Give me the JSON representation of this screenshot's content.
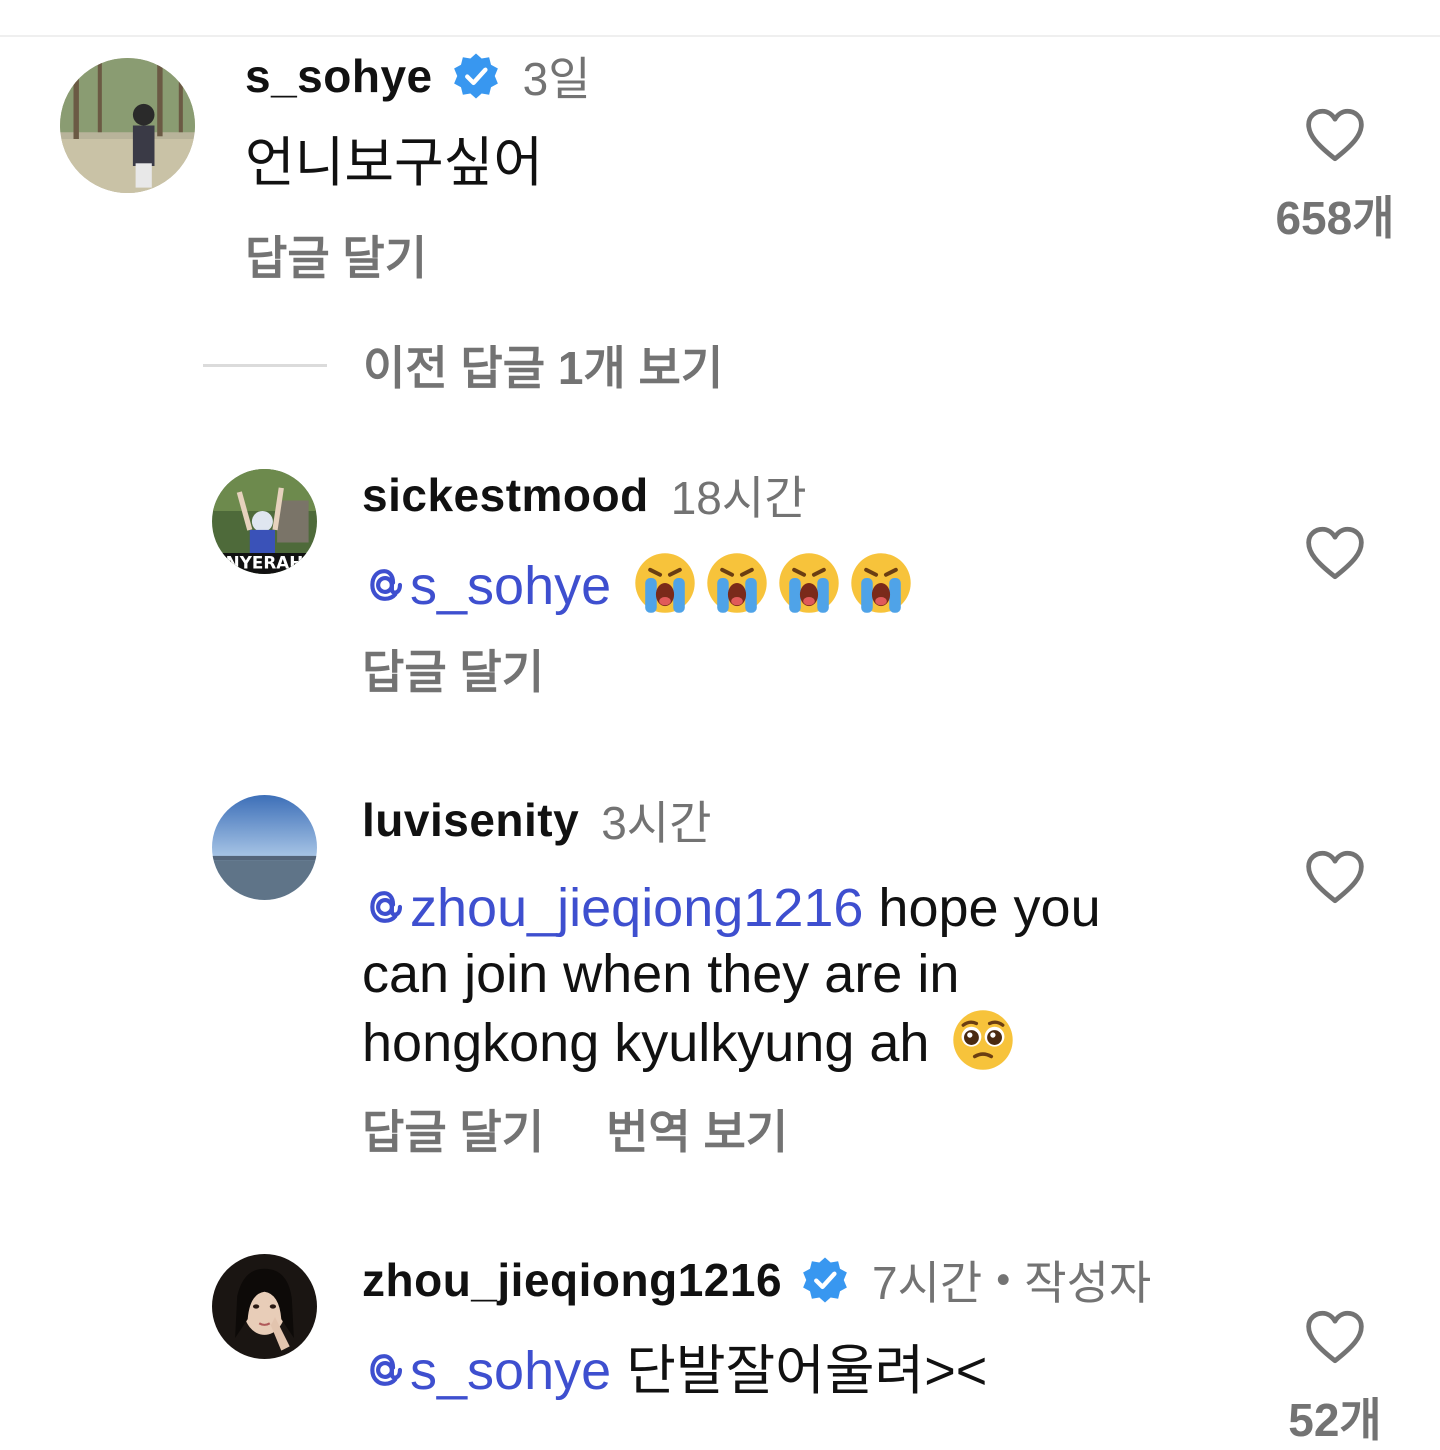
{
  "comments": [
    {
      "username": "s_sohye",
      "verified": true,
      "time": "3일",
      "text": "언니보구싶어",
      "reply_label": "답글 달기",
      "like_count": "658개"
    },
    {
      "username": "sickestmood",
      "verified": false,
      "time": "18시간",
      "mention": "s_sohye",
      "emoji": [
        "loudly-crying-face",
        "loudly-crying-face",
        "loudly-crying-face",
        "loudly-crying-face"
      ],
      "reply_label": "답글 달기"
    },
    {
      "username": "luvisenity",
      "verified": false,
      "time": "3시간",
      "mention": "zhou_jieqiong1216",
      "text_line1": " hope you",
      "text_line2": "can join when they are in",
      "text_line3": "hongkong kyulkyung ah ",
      "emoji": [
        "pleading-face"
      ],
      "reply_label": "답글 달기",
      "translate_label": "번역 보기"
    },
    {
      "username": "zhou_jieqiong1216",
      "verified": true,
      "time": "7시간",
      "separator": "•",
      "author_tag": "작성자",
      "mention": "s_sohye",
      "text": " 단발잘어울려><",
      "like_count": "52개"
    }
  ],
  "view_previous_replies": "이전 답글 1개 보기",
  "colors": {
    "mention": "#3e4fcf",
    "secondary_text": "#737373",
    "verified_badge": "#3897f0",
    "heart_outline": "#737373"
  }
}
